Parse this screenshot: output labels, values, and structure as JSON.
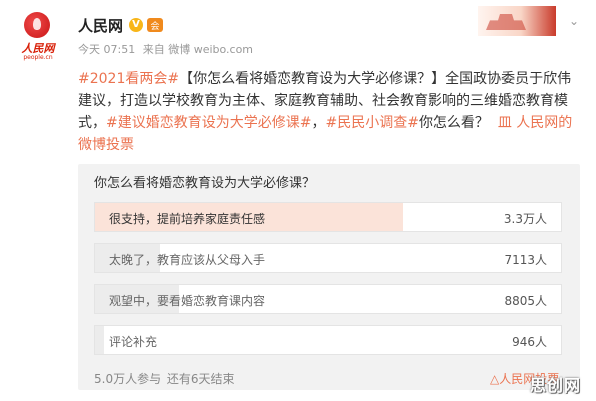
{
  "account": {
    "logo_text": "人民网",
    "logo_url": "people.cn",
    "name": "人民网",
    "verified_glyph": "V",
    "vip_glyph": "会",
    "time": "今天 07:51",
    "source": "来自 微博 weibo.com"
  },
  "post": {
    "hashtag_event": "#2021看两会#",
    "body_main": "【你怎么看将婚恋教育设为大学必修课？】全国政协委员于欣伟建议，打造以学校教育为主体、家庭教育辅助、社会教育影响的三维婚恋教育模式，",
    "hashtag_topic": "#建议婚恋教育设为大学必修课#",
    "separator": "，",
    "hashtag_survey": "#民民小调查#",
    "tail": "你怎么看？",
    "vote_link": "皿 人民网的微博投票"
  },
  "poll": {
    "question": "你怎么看将婚恋教育设为大学必修课？",
    "options": [
      {
        "label": "很支持，提前培养家庭责任感",
        "count": "3.3万人",
        "share": 0.66
      },
      {
        "label": "太晚了，教育应该从父母入手",
        "count": "7113人",
        "share": 0.14
      },
      {
        "label": "观望中，要看婚恋教育课内容",
        "count": "8805人",
        "share": 0.18
      },
      {
        "label": "评论补充",
        "count": "946人",
        "share": 0.02
      }
    ],
    "participants": "5.0万人参与",
    "remaining": "还有6天结束",
    "source_link": "△人民网投票"
  },
  "watermark": "思创网",
  "colors": {
    "accent": "#eb7350",
    "selected_fill": "#fbe3d9",
    "fill": "#ececec",
    "verified": "#f8b619",
    "brand_red": "#d81e06"
  },
  "icons": {
    "verified": "verified-badge-icon",
    "vip": "vip-badge-icon",
    "more": "chevron-down-icon"
  }
}
